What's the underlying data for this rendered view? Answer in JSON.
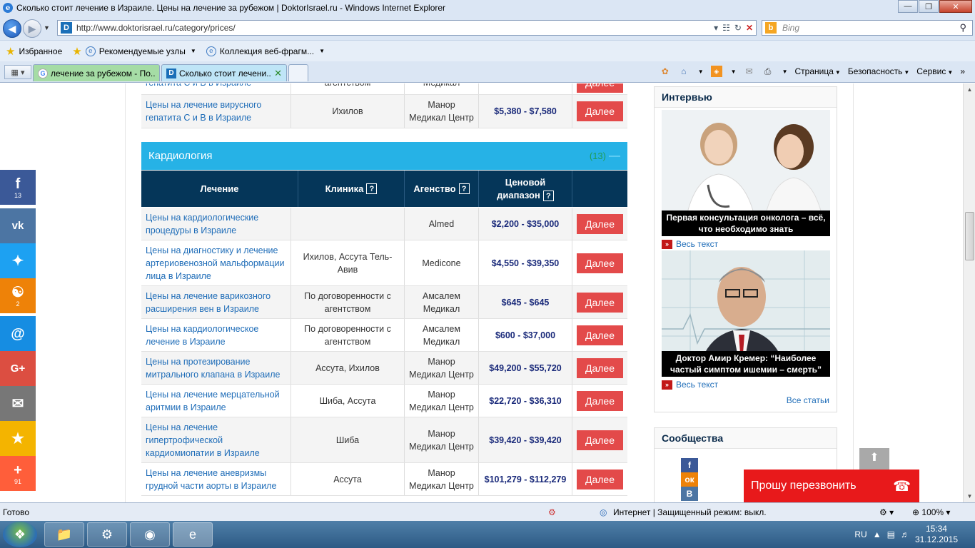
{
  "window": {
    "title": "Сколько стоит лечение в Израиле. Цены на лечение за рубежом | DoktorIsrael.ru - Windows Internet Explorer"
  },
  "address": {
    "url": "http://www.doktorisrael.ru/category/prices/",
    "search_placeholder": "Bing"
  },
  "favorites_bar": {
    "favorites": "Избранное",
    "recommended": "Рекомендуемые узлы",
    "gallery": "Коллекция веб-фрагм..."
  },
  "tabs": [
    {
      "label": "лечение за рубежом - По..."
    },
    {
      "label": "Сколько стоит лечени..."
    }
  ],
  "command_bar": {
    "page": "Страница",
    "safety": "Безопасность",
    "tools": "Сервис"
  },
  "prev_section_rows": [
    {
      "treatment": "гепатита C и B в Израиле",
      "clinic": "агентством",
      "agency": "Медикал",
      "price": "",
      "action": "Далее"
    },
    {
      "treatment": "Цены на лечение вирусного гепатита C и B в Израиле",
      "clinic": "Ихилов",
      "agency": "Манор Медикал Центр",
      "price": "$5,380 - $7,580",
      "action": "Далее"
    }
  ],
  "section": {
    "title": "Кардиология",
    "count": "(13)"
  },
  "table_header": {
    "treatment": "Лечение",
    "clinic": "Клиника",
    "agency": "Агенство",
    "price_l1": "Ценовой",
    "price_l2": "диапазон",
    "help": "?"
  },
  "rows": [
    {
      "treatment": "Цены на кардиологические процедуры в Израиле",
      "clinic": "",
      "agency": "Almed",
      "price": "$2,200 - $35,000",
      "action": "Далее"
    },
    {
      "treatment": "Цены на диагностику и лечение артериовенозной мальформации лица в Израиле",
      "clinic": "Ихилов, Ассута Тель-Авив",
      "agency": "Medicone",
      "price": "$4,550 - $39,350",
      "action": "Далее"
    },
    {
      "treatment": "Цены на лечение варикозного расширения вен в Израиле",
      "clinic": "По договоренности с агентством",
      "agency": "Амсалем Медикал",
      "price": "$645 - $645",
      "action": "Далее"
    },
    {
      "treatment": "Цены на кардиологическое лечение в Израиле",
      "clinic": "По договоренности с агентством",
      "agency": "Амсалем Медикал",
      "price": "$600 - $37,000",
      "action": "Далее"
    },
    {
      "treatment": "Цены на протезирование митрального клапана в Израиле",
      "clinic": "Ассута, Ихилов",
      "agency": "Манор Медикал Центр",
      "price": "$49,200 - $55,720",
      "action": "Далее"
    },
    {
      "treatment": "Цены на лечение мерцательной аритмии в Израиле",
      "clinic": "Шиба, Ассута",
      "agency": "Манор Медикал Центр",
      "price": "$22,720 - $36,310",
      "action": "Далее"
    },
    {
      "treatment": "Цены на лечение гипертрофической кардиомиопатии в Израиле",
      "clinic": "Шиба",
      "agency": "Манор Медикал Центр",
      "price": "$39,420 - $39,420",
      "action": "Далее"
    },
    {
      "treatment": "Цены на лечение аневризмы грудной части аорты в Израиле",
      "clinic": "Ассута",
      "agency": "Манор Медикал Центр",
      "price": "$101,279 - $112,279",
      "action": "Далее"
    }
  ],
  "sidebar": {
    "interview_title": "Интервью",
    "card1_caption": "Первая консультация онколога – всё, что необходимо знать",
    "card2_caption": "Доктор Амир Кремер: “Наиболее частый симптом ишемии – смерть”",
    "read_more": "Весь текст",
    "all_articles": "Все статьи",
    "communities_title": "Сообщества"
  },
  "share": [
    {
      "icon": "f",
      "count": "13",
      "color": "#3b5998"
    },
    {
      "icon": "vk",
      "count": "",
      "color": "#4c75a3"
    },
    {
      "icon": "tw",
      "count": "",
      "color": "#1da1f2"
    },
    {
      "icon": "ok",
      "count": "2",
      "color": "#ee8208"
    },
    {
      "icon": "@",
      "count": "",
      "color": "#168de2"
    },
    {
      "icon": "G+",
      "count": "",
      "color": "#dc4e41"
    },
    {
      "icon": "mail",
      "count": "",
      "color": "#777777"
    },
    {
      "icon": "star",
      "count": "",
      "color": "#f4b400"
    },
    {
      "icon": "+",
      "count": "91",
      "color": "#ff5e3a"
    }
  ],
  "callback": "Прошу перезвонить",
  "totop": "ВВЕРХ",
  "status": {
    "ready": "Готово",
    "zone": "Интернет | Защищенный режим: выкл.",
    "zoom": "100%"
  },
  "taskbar": {
    "lang": "RU",
    "time": "15:34",
    "date": "31.12.2015"
  }
}
